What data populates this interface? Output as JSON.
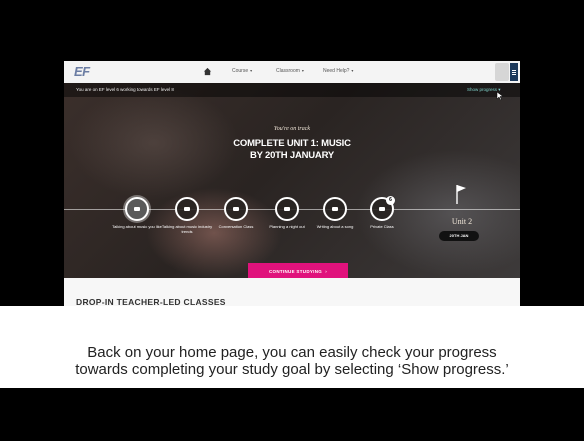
{
  "nav": {
    "logo": "EF",
    "items": [
      "Course",
      "Classroom",
      "Need Help?"
    ]
  },
  "status": {
    "text": "You are on EF level 6 working towards EF level 8",
    "show_progress": "Show progress"
  },
  "hero": {
    "on_track": "You're on track",
    "goal_line1": "COMPLETE UNIT 1: MUSIC",
    "goal_line2": "BY 20TH JANUARY",
    "steps": [
      "Talking about music you like",
      "Talking about music industry trends",
      "Conversation Class",
      "Planning a night out",
      "Writing about a song",
      "Private Class"
    ],
    "private_class_count": "6",
    "unit_label": "Unit 2",
    "unit_date": "20TH JAN",
    "continue_button": "CONTINUE STUDYING"
  },
  "lower": {
    "heading": "DROP-IN TEACHER-LED CLASSES"
  },
  "caption": {
    "line1": "Back on your home page, you can easily check your progress",
    "line2": "towards completing your study goal by selecting ‘Show progress.’"
  },
  "colors": {
    "accent": "#e0127c",
    "progress_link": "#7ed1c9",
    "nav_dark": "#1d3a5c"
  }
}
